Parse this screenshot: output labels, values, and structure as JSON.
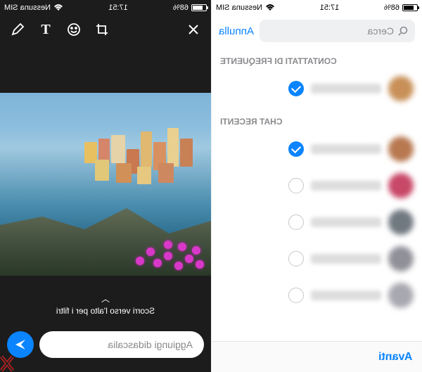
{
  "status_bar": {
    "battery_pct": "68%",
    "time": "17:51",
    "carrier": "Nessuna SIM",
    "wifi_glyph": "▶",
    "signal_glyph": "••••"
  },
  "left_screen": {
    "tools": {
      "draw": "draw",
      "text": "T",
      "emoji": "emoji",
      "crop": "crop",
      "close": "close"
    },
    "swipe_hint": "Scorri verso l'alto per i filtri",
    "caption_placeholder": "Aggiungi didascalia"
  },
  "right_screen": {
    "search": {
      "placeholder": "Cerca",
      "cancel": "Annulla"
    },
    "sections": {
      "frequent": "CONTATTATI DI FREQUENTE",
      "recent": "CHAT RECENTI"
    },
    "contacts_frequent": [
      {
        "avatar_color": "#c89058",
        "selected": true
      }
    ],
    "contacts_recent": [
      {
        "avatar_color": "#b87850",
        "selected": true
      },
      {
        "avatar_color": "#c84868",
        "selected": false
      },
      {
        "avatar_color": "#707880",
        "selected": false
      },
      {
        "avatar_color": "#909098",
        "selected": false
      },
      {
        "avatar_color": "#a8a8b0",
        "selected": false
      }
    ],
    "footer": {
      "next": "Avanti"
    }
  },
  "colors": {
    "accent": "#0a84ff",
    "dark_bg": "#1c1c1c"
  }
}
